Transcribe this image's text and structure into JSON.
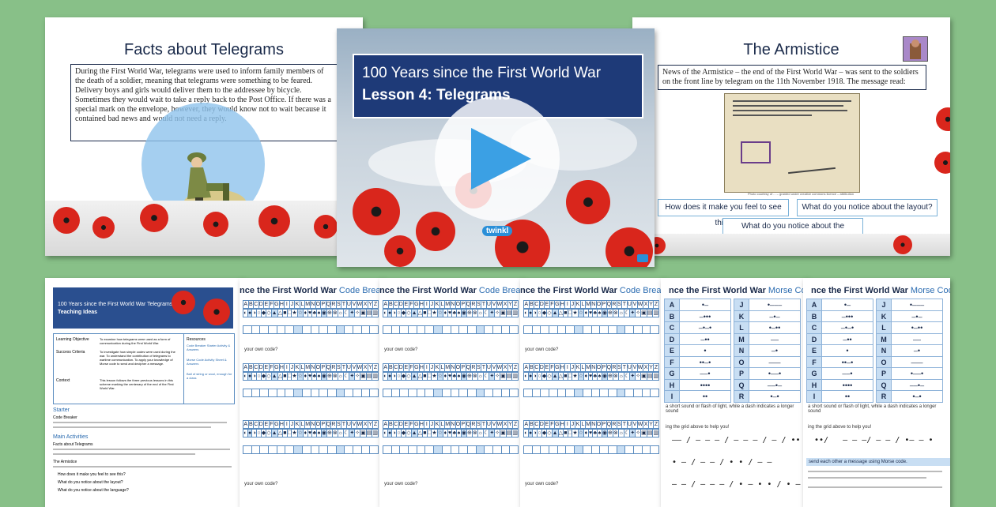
{
  "slide_facts": {
    "title": "Facts about Telegrams",
    "body": "During the First World War, telegrams were used to inform family members of the death of a soldier, meaning that telegrams were something to be feared. Delivery boys and girls would deliver them to the addressee by bicycle. Sometimes they would wait to take a reply back to the Post Office. If there was a special mark on the envelope, however, they would know not to wait because it contained bad news and would not need a reply."
  },
  "slide_cover": {
    "line1": "100 Years since the First World War",
    "line2": "Lesson 4: Telegrams",
    "logo": "twinkl"
  },
  "slide_armistice": {
    "title": "The Armistice",
    "body": "News of the Armistice – the end of the First World War – was sent to the soldiers on the front line by telegram on the 11th November 1918. The message read:",
    "caption": "Photo courtesy of ... – granted under creative commons licence – attribution",
    "questions": [
      "How does it make you feel to see this?",
      "What do you notice about the layout?",
      "What do you notice about the language?"
    ]
  },
  "doc_teaching": {
    "banner_line1": "100 Years since the First World War Telegrams",
    "banner_line2": "Teaching Ideas",
    "rows": [
      {
        "label": "Learning Objective",
        "text": "To examine how telegrams were used as a form of communication during the First World War."
      },
      {
        "label": "Success Criteria",
        "text": "To investigate how simple codes were used during the war. To understand the contribution of telegrams to wartime communication. To apply your knowledge of Morse code to send and decipher a message."
      },
      {
        "label": "Context",
        "text": "This lesson follows the three previous lessons in this scheme marking the centenary of the end of the First World War."
      }
    ],
    "resources_label": "Resources",
    "resources": [
      "Code Breaker Starter Activity & Answers",
      "Morse Code Activity Sheet & Answers",
      "Ball of string or wool, enough for a class"
    ],
    "starter_heading": "Starter",
    "starter_sub": "Code Breaker",
    "main_heading": "Main Activities",
    "main_sub1": "Facts about Telegrams",
    "main_sub2": "The Armistice",
    "bullets": [
      "How does it make you feel to see this?",
      "What do you notice about the layout?",
      "What do you notice about the language?"
    ]
  },
  "ws_code_breaker": {
    "title_prefix": "nce the First World War",
    "title_accent": "Code Breaker",
    "alphabet": [
      "A",
      "B",
      "C",
      "D",
      "E",
      "F",
      "G",
      "H",
      "I",
      "J",
      "K",
      "L",
      "M",
      "N",
      "O",
      "P",
      "Q",
      "R",
      "S",
      "T",
      "U",
      "V",
      "W",
      "X",
      "Y",
      "Z"
    ],
    "prompt": "your own code?"
  },
  "ws_morse": {
    "title_prefix": "nce the First World War",
    "title_accent": "Morse Code",
    "note": "a short sound or flash of light, while a dash indicates a longer sound",
    "help": "ing the grid above to help you!",
    "send": "send each other a message using Morse code."
  },
  "colors": {
    "background": "#88c088",
    "navy": "#1a2a4a",
    "accent": "#2a6bb0",
    "poppy": "#d9261c"
  }
}
